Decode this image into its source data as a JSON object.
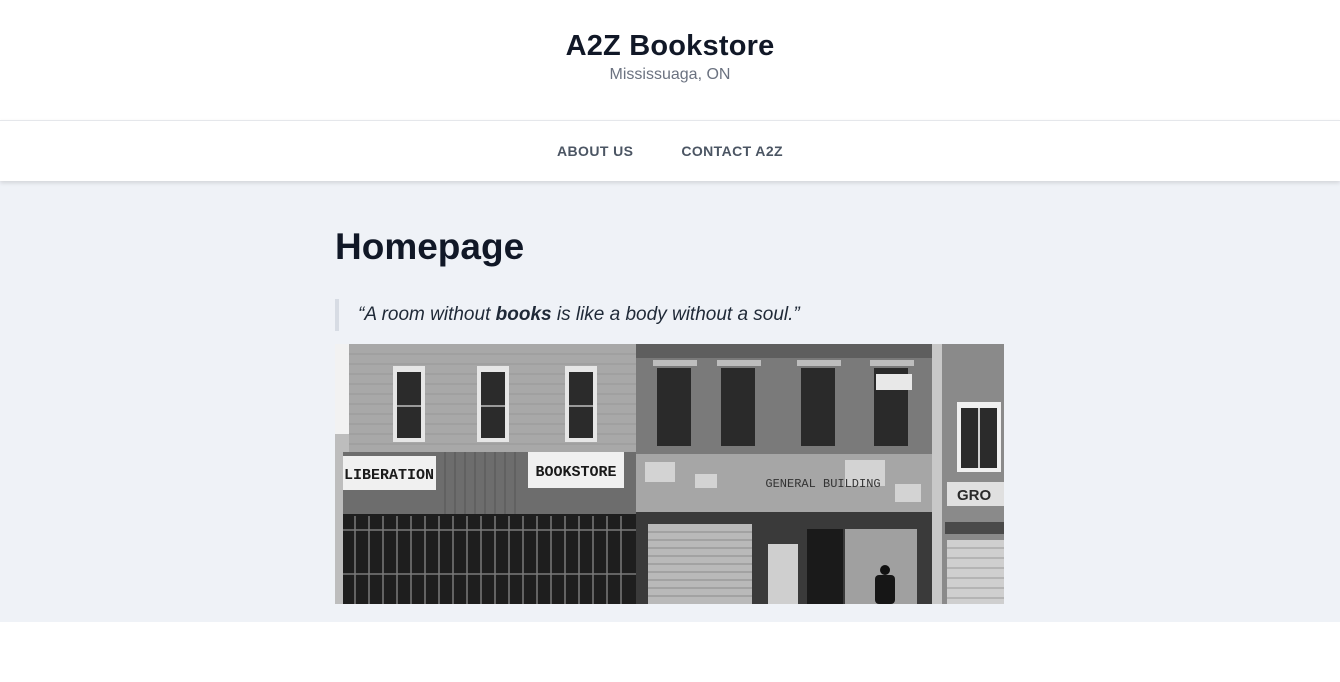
{
  "site": {
    "title": "A2Z Bookstore",
    "subtitle": "Mississuaga, ON"
  },
  "nav": {
    "items": [
      {
        "label": "ABOUT US"
      },
      {
        "label": "CONTACT A2Z"
      }
    ]
  },
  "main": {
    "page_title": "Homepage",
    "quote": {
      "before": "“A room without ",
      "emphasis": "books",
      "after": " is like a body without a soul.”"
    },
    "photo": {
      "signs": {
        "left": "LIBERATION",
        "middle": "BOOKSTORE",
        "faded": "GENERAL BUILDING",
        "right": "GRO"
      }
    }
  },
  "colors": {
    "header_bg": "#ffffff",
    "content_bg": "#eff2f7",
    "title_text": "#111827",
    "nav_text": "#4b5563",
    "subtitle_text": "#6b7280"
  }
}
